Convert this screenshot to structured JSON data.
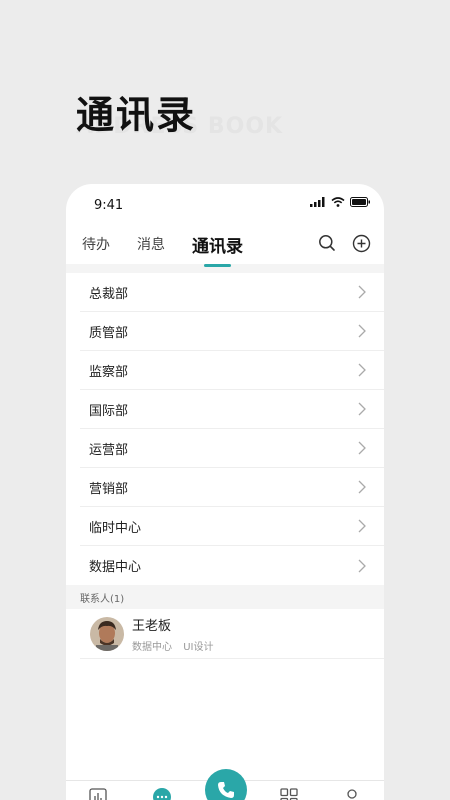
{
  "hero": {
    "title": "通讯录",
    "subtitle": "ADDRESS BOOK"
  },
  "status_bar": {
    "time": "9:41"
  },
  "tabs": [
    {
      "label": "待办"
    },
    {
      "label": "消息"
    },
    {
      "label": "通讯录"
    }
  ],
  "departments": [
    {
      "label": "总裁部"
    },
    {
      "label": "质管部"
    },
    {
      "label": "监察部"
    },
    {
      "label": "国际部"
    },
    {
      "label": "运营部"
    },
    {
      "label": "营销部"
    },
    {
      "label": "临时中心"
    },
    {
      "label": "数据中心"
    }
  ],
  "contacts_section": {
    "header": "联系人(1)"
  },
  "contacts": [
    {
      "name": "王老板",
      "department": "数据中心",
      "role": "UI设计"
    }
  ],
  "colors": {
    "accent": "#2aa7a8",
    "background": "#ececec"
  },
  "icons": {
    "search": "search-icon",
    "add": "add-circle-icon",
    "chevron": "chevron-right-icon",
    "signal": "signal-icon",
    "wifi": "wifi-icon",
    "battery": "battery-icon",
    "phone": "phone-icon"
  }
}
